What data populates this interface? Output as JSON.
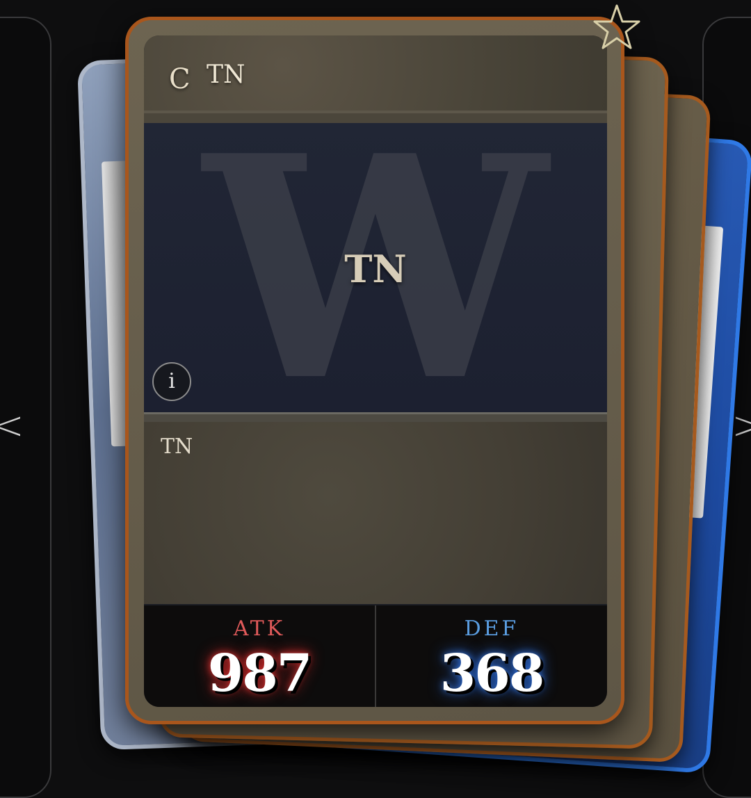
{
  "navigation": {
    "prev_label": "<",
    "next_label": ">"
  },
  "card": {
    "rarity": "C",
    "name": "TN",
    "art_letter": "W",
    "art_title": "TN",
    "info_label": "i",
    "description": "TN",
    "stats": {
      "atk_label": "ATK",
      "atk_value": "987",
      "def_label": "DEF",
      "def_value": "368"
    },
    "favorite_icon": "star-outline-icon"
  },
  "colors": {
    "frame_orange": "#a9561c",
    "silver_card": "#aeb8c9",
    "blue_card": "#2f79e6",
    "atk_red": "#e05a5a",
    "def_blue": "#5a9de0"
  }
}
